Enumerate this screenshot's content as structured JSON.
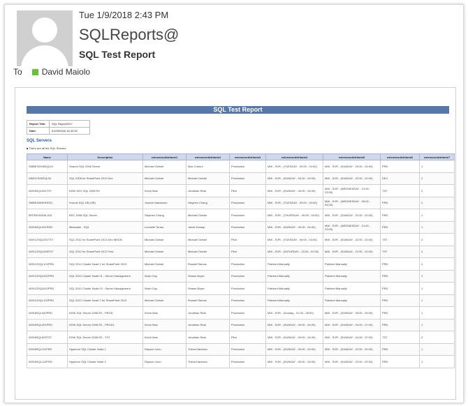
{
  "email": {
    "date": "Tue 1/9/2018 2:43 PM",
    "from": "SQLReports@",
    "subject": "SQL Test Report",
    "to_label": "To",
    "recipient": "David Maiolo",
    "presence_color": "#6cbf3c"
  },
  "report": {
    "title": "SQL Test Report",
    "meta": [
      {
        "key": "Report Title",
        "value": "SQL Report2017"
      },
      {
        "key": "Date",
        "value": "01/09/2018 14:42:33"
      }
    ],
    "section_title": "SQL Servers",
    "note": "There are all the SQL Servers",
    "columns": [
      "Name",
      "Description",
      "extensionAttribute1",
      "extensionAttribute2",
      "extensionAttribute3",
      "extensionAttribute4",
      "extensionAttribute5",
      "extensionAttribute6",
      "extensionAttribute7"
    ],
    "rows": [
      [
        "SMBES2008SQL01",
        "Shared SQL 2008 Server",
        "Michael Ochsle",
        "Max Coburn",
        "Production",
        "MW - SVR - (TUESDAY - 00:00 - 04:00)",
        "MW - SVR - (SUNDAY - 00:00 - 04:00)",
        "PRD",
        "1"
      ],
      [
        "WMSCS08SQL00",
        "SQL 2008 for SharePoint 2010 Dev",
        "Michael Ochsle",
        "Michael Ochsle",
        "Production",
        "MW - SVR - (SUNDAY - 00:00 - 04:00)",
        "MW - SVR - (SUNDAY - 22:00 - 02:00)",
        "DEV",
        "2"
      ],
      [
        "W2K8SQL001TST",
        "EDW DEV SQL 2008 R2",
        "Kevin Mao",
        "Jonathan Real",
        "Pilot",
        "MW - SVR - (SUNDAY - 00:00 - 04:00)",
        "MW - SVR - (WEDNESDAY - 21:00 - 23:00)",
        "TST",
        "2"
      ],
      [
        "SMBES08SHRD01",
        "Kronos SQL DB (HR)",
        "Joanne Nakamoto",
        "Stephen Chang",
        "Production",
        "MW - SVR - (TUESDAY - 00:00 - 04:00)",
        "MW - SVR - (WEDNESDAY - 00:00 - 04:00)",
        "PRD",
        "2"
      ],
      [
        "BFPRESDEAL003",
        "BSC 2008 SQL Server",
        "Stephen Chang",
        "Michael Ochsle",
        "Production",
        "MW - SVR - (THURSDAY - 00:00 - 04:00)",
        "MW - SVR - (SUNDAY - 22:00 - 02:00)",
        "PRD",
        "1"
      ],
      [
        "W2K8SQL201PRD",
        "Mirkwater - SQL",
        "Leonelle Torres",
        "Jamie Dunlap",
        "Production",
        "MW - SVR - (SUNDAY - 00:00 - 04:00)",
        "MW - SVR - (WEDNESDAY - 21:00 - 23:00)",
        "PRD",
        "1"
      ],
      [
        "W2K12SQL001TST",
        "SQL 2012 for SharePoint 2013 Dev MEDN",
        "Michael Ochsle",
        "Michael Ochsle",
        "Pilot",
        "MW - SVR - (TUESDAY - 00:00 - 04:00)",
        "MW - SVR - (SUNDAY - 22:00 - 02:00)",
        "TST",
        "2"
      ],
      [
        "W2K12SQL008TST",
        "SQL 2012 for SharePoint 2013 Test",
        "Michael Ochsle",
        "Michael Ochsle",
        "Pilot",
        "MW - SVR - (SATURDAY - 22:00 - 02:00)",
        "MW - SVR - (SUNDAY - 22:00 - 02:00)",
        "TST",
        "2"
      ],
      [
        "W2K12SQL101PRD",
        "SQL 2012 Cluster Node 1 for SharePoint 2013",
        "Michael Ochsle",
        "Russell Ramos",
        "Production",
        "Patched Manually",
        "Patched Manually",
        "PRD",
        "1"
      ],
      [
        "W2K12SQL501PRD",
        "SQL 2012 Cluster Node 01 - Server Management",
        "Noah Guy",
        "Shawn Boyer",
        "Production",
        "Patched Manually",
        "Patched Manually",
        "PRD",
        "1"
      ],
      [
        "W2K12SQL502PRD",
        "SQL 2012 Cluster Node 02 - Server Management",
        "Noah Guy",
        "Shawn Boyer",
        "Production",
        "Patched Manually",
        "Patched Manually",
        "PRD",
        "1"
      ],
      [
        "W2K12SQL102PRD",
        "SQL 2012 Cluster Node 2 for SharePoint 2013",
        "Michael Ochsle",
        "Russell Ramos",
        "Production",
        "Patched Manually",
        "Patched Manually",
        "PRD",
        "1"
      ],
      [
        "W2K8SQL400PRD",
        "EDW SQL Server 2008 R2 - PROD",
        "Kevin Mao",
        "Jonathan Real",
        "Production",
        "MW - SVR - (Sunday - 01:00 - 05:00)",
        "MW - SVR - (SUNDAY - 05:00 - 09:00)",
        "PRD",
        "1"
      ],
      [
        "W2K8SQL401PRD",
        "EDW SQL Server 2008 R2 - PROD1",
        "Kevin Mao",
        "Jonathan Real",
        "Production",
        "MW - SVR - (SUNDAY - 00:00 - 04:00)",
        "MW - SVR - (SUNDAY - 04:00 - 07:00)",
        "PRD",
        "1"
      ],
      [
        "W2K8SQL003TST",
        "EDW SQL Server 2008 R2 - TST",
        "Kevin Mao",
        "Jonathan Real",
        "Pilot",
        "MW - SVR - (SUNDAY - 00:00 - 04:00)",
        "MW - SVR - (SUNDAY - 04:00 - 07:00)",
        "TST",
        "2"
      ],
      [
        "W2K8SQL111PRD",
        "Hyperion SQL Cluster Node 1",
        "Rayson Leuu",
        "Trisha Hanesko",
        "Production",
        "MW - SVR - (SUNDAY - 00:00 - 04:00)",
        "MW - SVR - (SUNDAY - 22:00 - 02:00)",
        "PRD",
        "1"
      ],
      [
        "W2K8SQL112PRD",
        "Hyperion SQL Cluster Node 2",
        "Rayson Leuu",
        "Trisha Hanesko",
        "Production",
        "MW - SVR - (SUNDAY - 00:00 - 04:00)",
        "MW - SVR - (SUNDAY - 22:00 - 02:00)",
        "PRD",
        "1"
      ]
    ]
  }
}
